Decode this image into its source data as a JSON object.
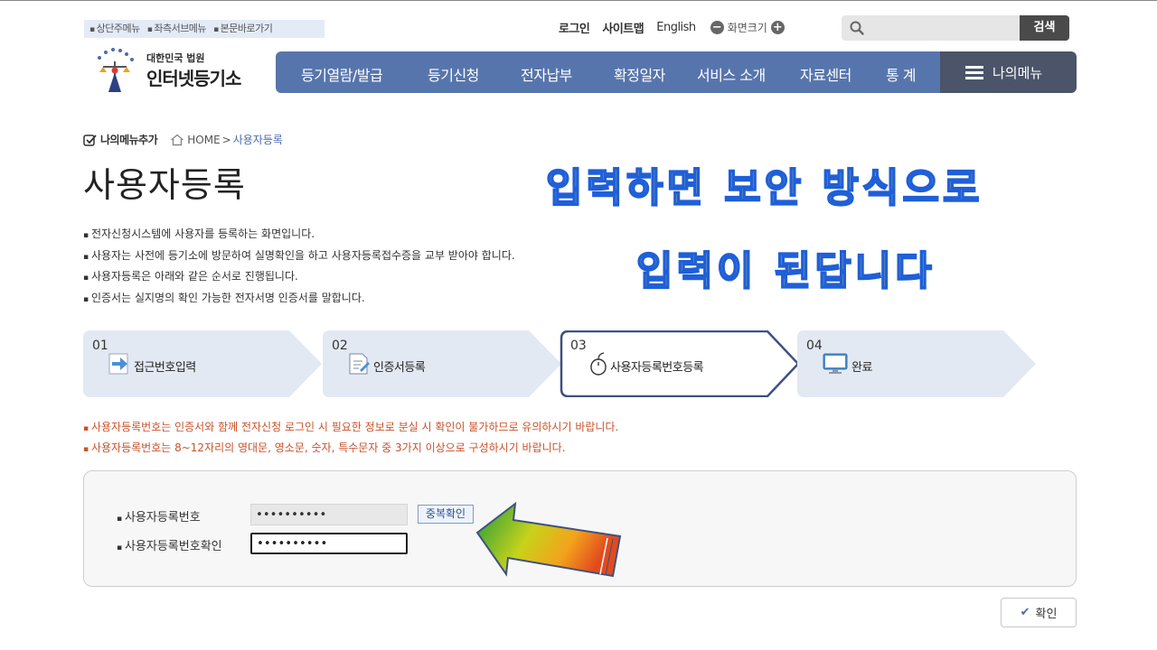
{
  "skip_links": [
    "상단주메뉴",
    "좌측서브메뉴",
    "본문바로가기"
  ],
  "util": {
    "login": "로그인",
    "sitemap": "사이트맵",
    "english": "English",
    "zoom_label": "화면크기",
    "zoom_minus": "−",
    "zoom_plus": "+"
  },
  "search": {
    "value": "",
    "button": "검색"
  },
  "logo": {
    "line1": "대한민국 법원",
    "line2": "인터넷등기소"
  },
  "gnb": [
    "등기열람/발급",
    "등기신청",
    "전자납부",
    "확정일자",
    "서비스 소개",
    "자료센터",
    "통 계"
  ],
  "my_menu": "나의메뉴",
  "breadcrumb": {
    "add_menu": "나의메뉴추가",
    "home": "HOME",
    "sep": ">",
    "current": "사용자등록"
  },
  "page_title": "사용자등록",
  "overlay": {
    "line1": "입력하면 보안 방식으로",
    "line2": "입력이 된답니다"
  },
  "description": [
    "전자신청시스템에 사용자를 등록하는 화면입니다.",
    "사용자는 사전에 등기소에 방문하여 실명확인을 하고 사용자등록접수증을 교부 받아야 합니다.",
    "사용자등록은 아래와 같은 순서로 진행됩니다.",
    "인증서는 실지명의 확인 가능한 전자서명 인증서를 말합니다."
  ],
  "steps": [
    {
      "num": "01",
      "label": "접근번호입력",
      "icon": "arrow-right-icon",
      "active": false
    },
    {
      "num": "02",
      "label": "인증서등록",
      "icon": "document-edit-icon",
      "active": false
    },
    {
      "num": "03",
      "label": "사용자등록번호등록",
      "icon": "mouse-icon",
      "active": true
    },
    {
      "num": "04",
      "label": "완료",
      "icon": "monitor-icon",
      "active": false
    }
  ],
  "notes": [
    "사용자등록번호는 인증서와 함께 전자신청 로그인 시 필요한 정보로 분실 시 확인이 불가하므로 유의하시기 바랍니다.",
    "사용자등록번호는 8~12자리의 영대문, 영소문, 숫자, 특수문자 중 3가지 이상으로 구성하시기 바랍니다."
  ],
  "form": {
    "reg_no_label": "사용자등록번호",
    "reg_no_value": "••••••••••",
    "dup_check": "중복확인",
    "reg_no_confirm_label": "사용자등록번호확인",
    "reg_no_confirm_value": "••••••••••"
  },
  "confirm_button": "확인",
  "colors": {
    "gnb": "#5775ad",
    "my_menu": "#4b5468",
    "step_bg": "#e3e9f3",
    "step_active_border": "#3d5281",
    "note_text": "#c9522a",
    "overlay_fill": "#ffe14a",
    "overlay_stroke": "#1f5fd8"
  }
}
